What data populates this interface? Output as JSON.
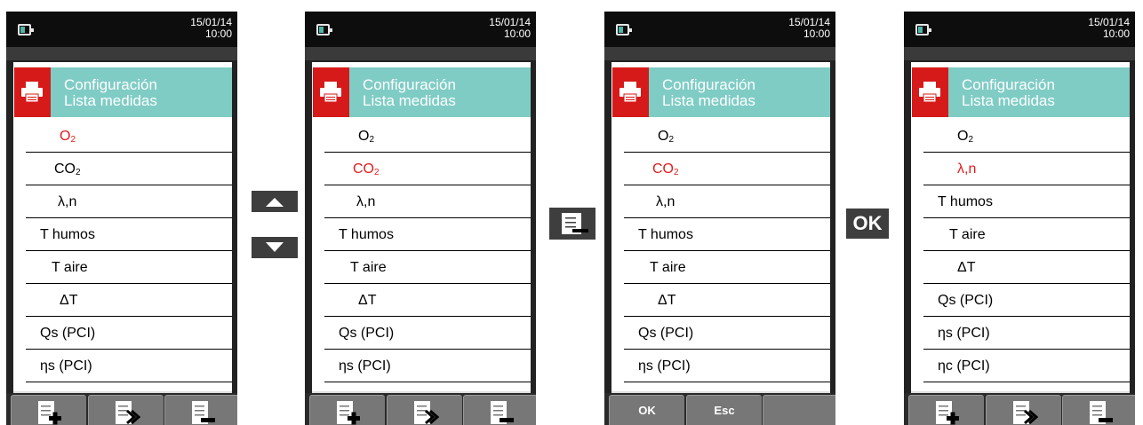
{
  "screens": [
    {
      "date": "15/01/14",
      "time": "10:00",
      "title1": "Configuración",
      "title2": "Lista medidas",
      "items": [
        {
          "base": "O",
          "sub": "2",
          "sel": true
        },
        {
          "base": "CO",
          "sub": "2",
          "sel": false
        },
        {
          "base": "λ,n",
          "sub": "",
          "sel": false
        },
        {
          "base": "T humos",
          "sub": "",
          "sel": false
        },
        {
          "base": "T aire",
          "sub": "",
          "sel": false
        },
        {
          "base": "ΔT",
          "sub": "",
          "sel": false
        },
        {
          "base": "Qs (PCI)",
          "sub": "",
          "sel": false
        },
        {
          "base": "ηs (PCI)",
          "sub": "",
          "sel": false
        }
      ],
      "softkeys": [
        "add-line-icon",
        "move-line-icon",
        "remove-line-icon"
      ]
    },
    {
      "date": "15/01/14",
      "time": "10:00",
      "title1": "Configuración",
      "title2": "Lista medidas",
      "items": [
        {
          "base": "O",
          "sub": "2",
          "sel": false
        },
        {
          "base": "CO",
          "sub": "2",
          "sel": true
        },
        {
          "base": "λ,n",
          "sub": "",
          "sel": false
        },
        {
          "base": "T humos",
          "sub": "",
          "sel": false
        },
        {
          "base": "T aire",
          "sub": "",
          "sel": false
        },
        {
          "base": "ΔT",
          "sub": "",
          "sel": false
        },
        {
          "base": "Qs (PCI)",
          "sub": "",
          "sel": false
        },
        {
          "base": "ηs (PCI)",
          "sub": "",
          "sel": false
        }
      ],
      "softkeys": [
        "add-line-icon",
        "move-line-icon",
        "remove-line-icon"
      ]
    },
    {
      "date": "15/01/14",
      "time": "10:00",
      "title1": "Configuración",
      "title2": "Lista medidas",
      "items": [
        {
          "base": "O",
          "sub": "2",
          "sel": false
        },
        {
          "base": "CO",
          "sub": "2",
          "sel": true
        },
        {
          "base": "λ,n",
          "sub": "",
          "sel": false
        },
        {
          "base": "T humos",
          "sub": "",
          "sel": false
        },
        {
          "base": "T aire",
          "sub": "",
          "sel": false
        },
        {
          "base": "ΔT",
          "sub": "",
          "sel": false
        },
        {
          "base": "Qs (PCI)",
          "sub": "",
          "sel": false
        },
        {
          "base": "ηs (PCI)",
          "sub": "",
          "sel": false
        }
      ],
      "softkeys_text": [
        "OK",
        "Esc",
        ""
      ]
    },
    {
      "date": "15/01/14",
      "time": "10:00",
      "title1": "Configuración",
      "title2": "Lista medidas",
      "items": [
        {
          "base": "O",
          "sub": "2",
          "sel": false
        },
        {
          "base": "λ,n",
          "sub": "",
          "sel": true
        },
        {
          "base": "T humos",
          "sub": "",
          "sel": false
        },
        {
          "base": "T aire",
          "sub": "",
          "sel": false
        },
        {
          "base": "ΔT",
          "sub": "",
          "sel": false
        },
        {
          "base": "Qs (PCI)",
          "sub": "",
          "sel": false
        },
        {
          "base": "ηs (PCI)",
          "sub": "",
          "sel": false
        },
        {
          "base": "ηc (PCI)",
          "sub": "",
          "sel": false
        }
      ],
      "softkeys": [
        "add-line-icon",
        "move-line-icon",
        "remove-line-icon"
      ]
    }
  ],
  "external_buttons": {
    "up": "up-arrow-icon",
    "down": "down-arrow-icon",
    "remove": "remove-line-icon",
    "ok_label": "OK"
  },
  "colors": {
    "accent": "#7fccc5",
    "selected": "#e21b1b",
    "printer": "#d61a1a"
  }
}
